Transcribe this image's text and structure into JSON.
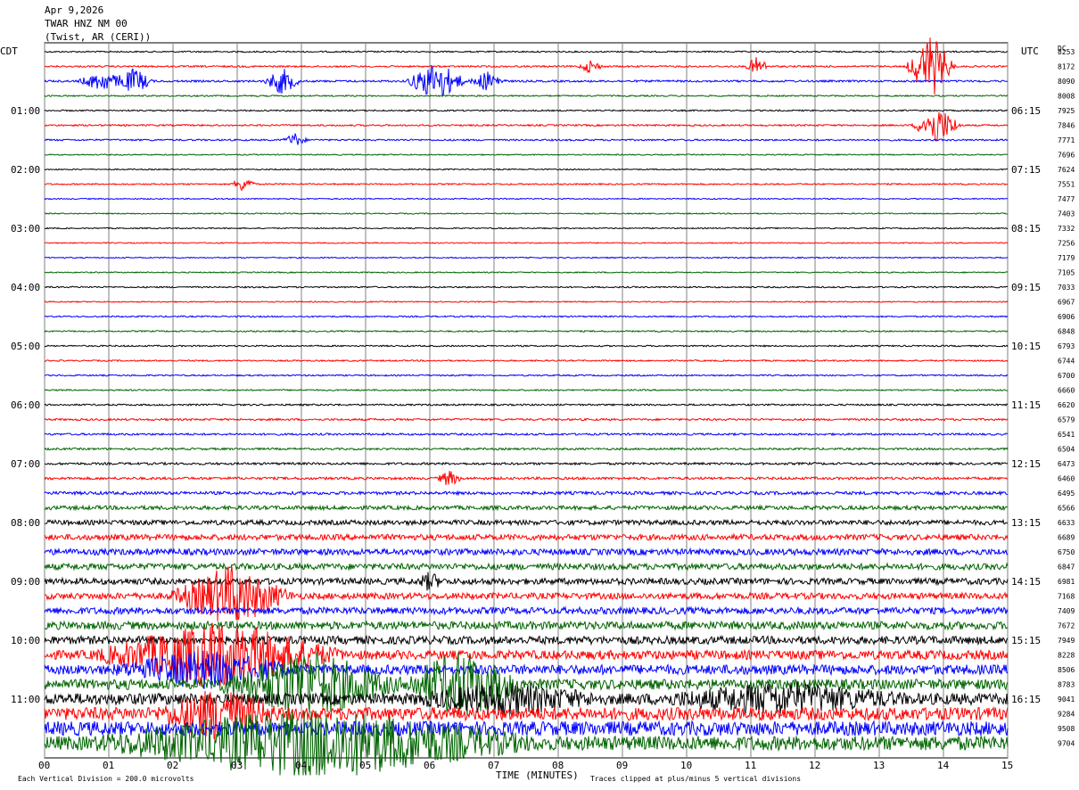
{
  "header": {
    "date": "Apr 9,2026",
    "station": "TWAR HNZ NM 00",
    "location": "(Twist, AR (CERI))"
  },
  "left_axis_label": "CDT",
  "right_axis_label": "UTC",
  "dc_label": "DC",
  "footer": {
    "scale": "Each Vertical Division = 200.0 microvolts",
    "xlabel": "TIME (MINUTES)",
    "clip_note": "Traces clipped at plus/minus 5 vertical divisions"
  },
  "colors": {
    "trace_cycle": [
      "#000000",
      "#ff0000",
      "#0000ff",
      "#006400"
    ],
    "grid": "#808080"
  },
  "chart_data": {
    "type": "line",
    "title": "",
    "xlabel": "TIME (MINUTES)",
    "xlim": [
      0,
      15
    ],
    "x_ticks": [
      "00",
      "01",
      "02",
      "03",
      "04",
      "05",
      "06",
      "07",
      "08",
      "09",
      "10",
      "11",
      "12",
      "13",
      "14",
      "15"
    ],
    "trace_minutes": 15,
    "left_time_labels": [
      "01:00",
      "02:00",
      "03:00",
      "04:00",
      "05:00",
      "06:00",
      "07:00",
      "08:00",
      "09:00",
      "10:00",
      "11:00"
    ],
    "right_time_labels": [
      "06:15",
      "07:15",
      "08:15",
      "09:15",
      "10:15",
      "11:15",
      "12:15",
      "13:15",
      "14:15",
      "15:15",
      "16:15"
    ],
    "dc_offsets": [
      8253,
      8172,
      8090,
      8008,
      7925,
      7846,
      7771,
      7696,
      7624,
      7551,
      7477,
      7403,
      7332,
      7256,
      7179,
      7105,
      7033,
      6967,
      6906,
      6848,
      6793,
      6744,
      6700,
      6660,
      6620,
      6579,
      6541,
      6504,
      6473,
      6460,
      6495,
      6566,
      6633,
      6689,
      6750,
      6847,
      6981,
      7168,
      7409,
      7672,
      7949,
      8228,
      8506,
      8783,
      9041,
      9284,
      9508,
      9704
    ],
    "trace_noise_level": [
      0.5,
      0.6,
      0.7,
      0.5,
      0.5,
      0.6,
      0.6,
      0.4,
      0.4,
      0.5,
      0.4,
      0.4,
      0.4,
      0.4,
      0.4,
      0.4,
      0.5,
      0.4,
      0.5,
      0.5,
      0.5,
      0.5,
      0.5,
      0.5,
      0.6,
      0.7,
      0.7,
      0.7,
      0.8,
      0.9,
      1.1,
      1.4,
      1.7,
      2.0,
      2.2,
      2.2,
      2.2,
      2.2,
      2.4,
      2.8,
      2.8,
      3.2,
      3.4,
      3.6,
      4.0,
      4.5,
      5.0,
      5.0
    ],
    "events": [
      {
        "trace": 1,
        "minute": 13.8,
        "amplitude": 5,
        "duration": 0.4
      },
      {
        "trace": 1,
        "minute": 11.1,
        "amplitude": 1.5,
        "duration": 0.2
      },
      {
        "trace": 1,
        "minute": 8.5,
        "amplitude": 1.0,
        "duration": 0.2
      },
      {
        "trace": 2,
        "minute": 0.9,
        "amplitude": 1.5,
        "duration": 0.4
      },
      {
        "trace": 2,
        "minute": 1.4,
        "amplitude": 2.0,
        "duration": 0.3
      },
      {
        "trace": 2,
        "minute": 3.7,
        "amplitude": 2.0,
        "duration": 0.3
      },
      {
        "trace": 2,
        "minute": 6.1,
        "amplitude": 3.0,
        "duration": 0.5
      },
      {
        "trace": 2,
        "minute": 6.9,
        "amplitude": 1.5,
        "duration": 0.3
      },
      {
        "trace": 5,
        "minute": 13.9,
        "amplitude": 3.0,
        "duration": 0.4
      },
      {
        "trace": 6,
        "minute": 3.9,
        "amplitude": 1.0,
        "duration": 0.2
      },
      {
        "trace": 9,
        "minute": 3.1,
        "amplitude": 1.2,
        "duration": 0.2
      },
      {
        "trace": 29,
        "minute": 6.3,
        "amplitude": 1.2,
        "duration": 0.2
      },
      {
        "trace": 36,
        "minute": 6.0,
        "amplitude": 1.2,
        "duration": 0.2
      },
      {
        "trace": 37,
        "minute": 2.9,
        "amplitude": 4.5,
        "duration": 1.0
      },
      {
        "trace": 41,
        "minute": 2.7,
        "amplitude": 5,
        "duration": 2.0
      },
      {
        "trace": 42,
        "minute": 2.5,
        "amplitude": 2.5,
        "duration": 1.5
      },
      {
        "trace": 43,
        "minute": 4.1,
        "amplitude": 5,
        "duration": 1.5
      },
      {
        "trace": 43,
        "minute": 6.5,
        "amplitude": 5,
        "duration": 1.0
      },
      {
        "trace": 44,
        "minute": 7.2,
        "amplitude": 2.0,
        "duration": 1.5
      },
      {
        "trace": 44,
        "minute": 11.5,
        "amplitude": 2.0,
        "duration": 2.0
      },
      {
        "trace": 45,
        "minute": 2.7,
        "amplitude": 3.5,
        "duration": 1.0
      },
      {
        "trace": 47,
        "minute": 4.2,
        "amplitude": 5,
        "duration": 3.5
      }
    ]
  }
}
